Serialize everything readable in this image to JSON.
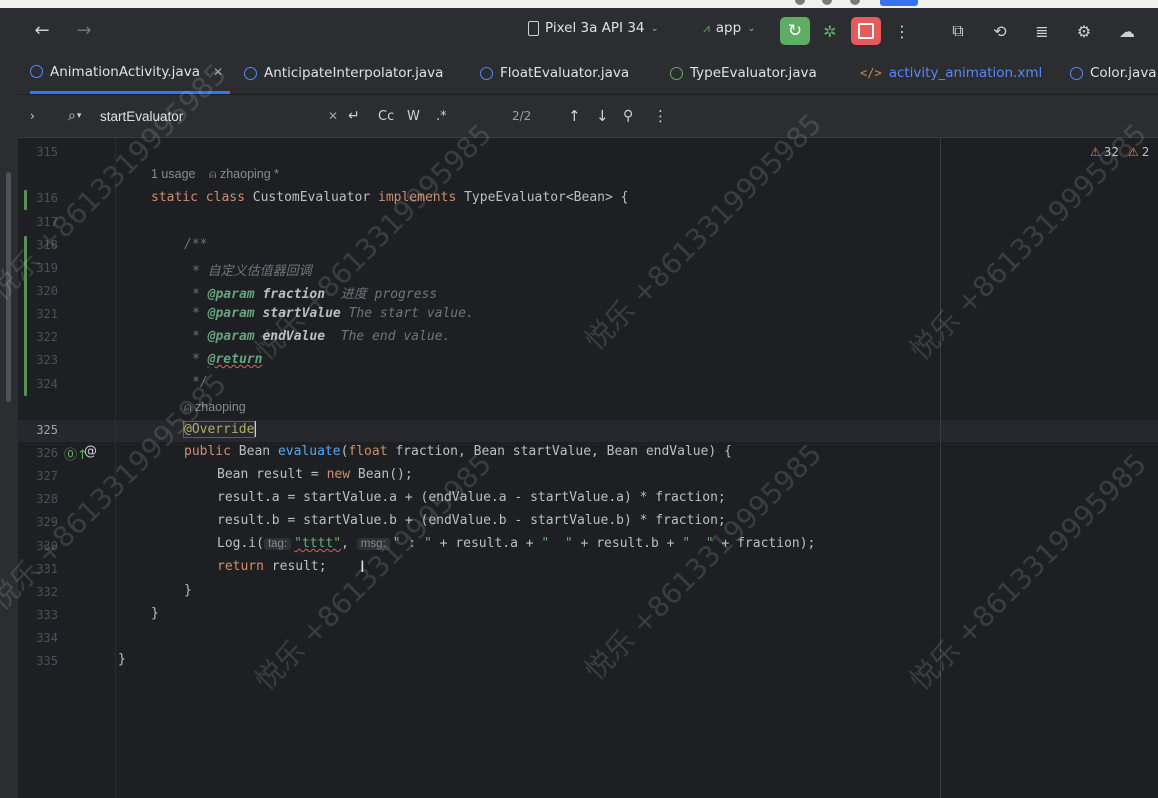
{
  "toolbar": {
    "device": "Pixel 3a API 34",
    "config": "app"
  },
  "tabs": [
    {
      "label": "AnimationActivity.java",
      "active": true,
      "icon": "class-icon"
    },
    {
      "label": "AnticipateInterpolator.java",
      "icon": "class-icon"
    },
    {
      "label": "FloatEvaluator.java",
      "icon": "class-icon"
    },
    {
      "label": "TypeEvaluator.java",
      "icon": "interface-icon"
    },
    {
      "label": "activity_animation.xml",
      "icon": "xml-icon"
    },
    {
      "label": "Color.java",
      "icon": "class-icon"
    }
  ],
  "find": {
    "query": "startEvaluator",
    "case_label": "Cc",
    "word_label": "W",
    "regex_label": ".*",
    "count": "2/2"
  },
  "inspections": {
    "warnings": "32",
    "weak_warnings": "2"
  },
  "editor": {
    "line_numbers": [
      "315",
      "316",
      "317",
      "318",
      "319",
      "320",
      "321",
      "322",
      "323",
      "324",
      "325",
      "326",
      "327",
      "328",
      "329",
      "330",
      "331",
      "332",
      "333",
      "334",
      "335"
    ],
    "current_line": "325",
    "hints": {
      "usage": "1 usage",
      "author_class": "zhaoping *",
      "author_method": "zhaoping"
    },
    "code": {
      "l316_kw1": "static",
      "l316_kw2": "class",
      "l316_name": "CustomEvaluator",
      "l316_kw3": "implements",
      "l316_rest": "TypeEvaluator<Bean> {",
      "l318": "/**",
      "l319": "* 自定义估值器回调",
      "l320_star": "*",
      "l320_tag": "@param",
      "l320_param": "fraction",
      "l320_desc": "  进度 progress",
      "l321_star": "*",
      "l321_tag": "@param",
      "l321_param": "startValue",
      "l321_desc": "The start value.",
      "l322_star": "*",
      "l322_tag": "@param",
      "l322_param": "endValue",
      "l322_desc": "  The end value.",
      "l323_star": "*",
      "l323_tag": "@return",
      "l324": "*/",
      "l325": "@Override",
      "l326_kw": "public",
      "l326_type": "Bean",
      "l326_fn": "evaluate",
      "l326_open": "(",
      "l326_float": "float",
      "l326_rest": "fraction, Bean startValue, Bean endValue) {",
      "l327_pre": "Bean result = ",
      "l327_new": "new",
      "l327_post": " Bean();",
      "l328": "result.a = startValue.a + (endValue.a - startValue.a) * fraction;",
      "l329": "result.b = startValue.b + (endValue.b - startValue.b) * fraction;",
      "l330_pre": "Log.i(",
      "l330_tag_hint": "tag:",
      "l330_tag_val": "\"tttt\"",
      "l330_comma": ", ",
      "l330_msg_hint": "msg:",
      "l330_str1": "\" : \"",
      "l330_mid1": " + result.a + ",
      "l330_str2": "\"  \"",
      "l330_mid2": " + result.b + ",
      "l330_str3": "\"  \"",
      "l330_end": " + fraction);",
      "l331_kw": "return",
      "l331_rest": " result;",
      "l332": "}",
      "l333": "}",
      "l335": "}"
    }
  },
  "watermark": "悦乐 +8613319995985"
}
